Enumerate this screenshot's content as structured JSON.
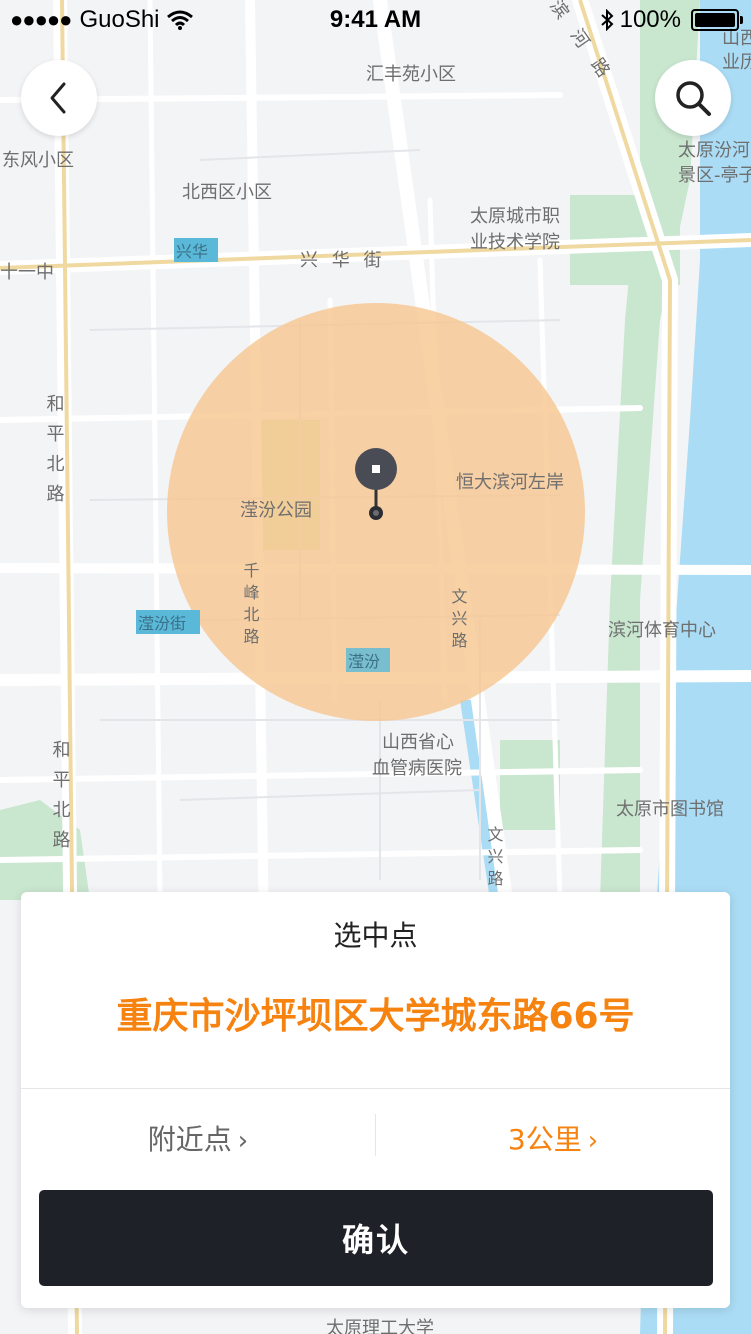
{
  "status_bar": {
    "carrier": "GuoShi",
    "time": "9:41 AM",
    "battery": "100%"
  },
  "map": {
    "labels": {
      "huifengyuan": "汇丰苑小区",
      "dongfeng": "东风小区",
      "beixiqu": "北西区小区",
      "xinghua_badge": "兴华",
      "xinghua_street": "兴 华 街",
      "shiyi": "十一中",
      "tyvocational_1": "太原城市职",
      "tyvocational_2": "业技术学院",
      "fenhe_scenic_1": "太原汾河",
      "fenhe_scenic_2": "景区-亭子",
      "shanxi_top_1": "山西",
      "shanxi_top_2": "业历",
      "river_rd_top": "滨 河 路",
      "hengda": "恒大滨河左岸",
      "yingfen_park": "滢汾公园",
      "binhe_stadium": "滨河体育中心",
      "yingfen_st": "滢汾街",
      "yingfen_badge": "滢汾",
      "hospital_1": "山西省心",
      "hospital_2": "血管病医院",
      "library": "太原市图书馆",
      "tut": "太原理工大学",
      "heping_1": "和平北路",
      "heping_2": "和平北路",
      "qianfeng": "千峰北路",
      "wenxing_1": "文兴路",
      "wenxing_2": "文兴路"
    }
  },
  "sheet": {
    "title": "选中点",
    "address": "重庆市沙坪坝区大学城东路66号",
    "nearby_label": "附近点",
    "radius_label": "3公里",
    "chevron": "›",
    "confirm_label": "确认"
  },
  "colors": {
    "accent": "#f6820f",
    "radius_fill": "#f7c791",
    "button_bg": "#1f2129",
    "water": "#aadcf5",
    "park": "#c9e6cf"
  }
}
